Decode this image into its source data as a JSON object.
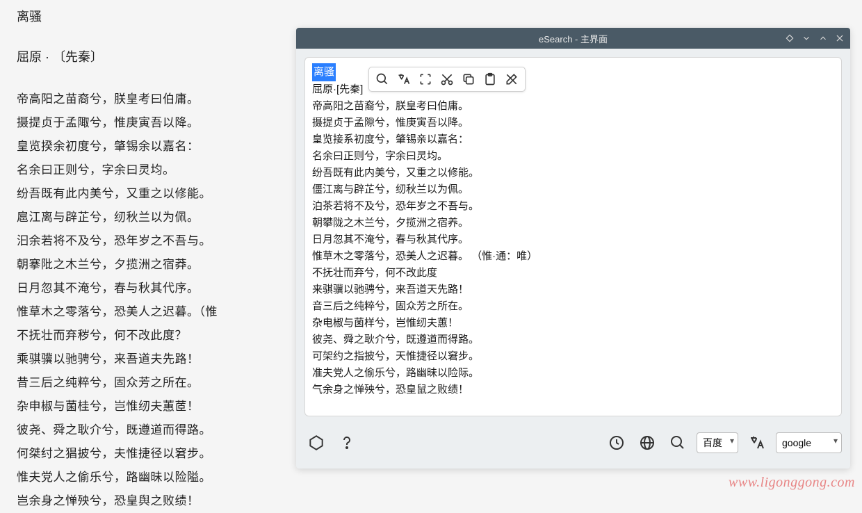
{
  "background": {
    "title": "离骚",
    "author": "屈原 · 〔先秦〕",
    "lines": [
      "帝高阳之苗裔兮，朕皇考曰伯庸。",
      "摄提贞于孟陬兮，惟庚寅吾以降。",
      "皇览揆余初度兮，肇锡余以嘉名：",
      "名余曰正则兮，字余曰灵均。",
      "纷吾既有此内美兮，又重之以修能。",
      "扈江离与辟芷兮，纫秋兰以为佩。",
      "汩余若将不及兮，恐年岁之不吾与。",
      "朝搴阰之木兰兮，夕揽洲之宿莽。",
      "日月忽其不淹兮，春与秋其代序。",
      "惟草木之零落兮，恐美人之迟暮。（惟",
      "不抚壮而弃秽兮，何不改此度？",
      "乘骐骥以驰骋兮，来吾道夫先路！",
      "昔三后之纯粹兮，固众芳之所在。",
      "杂申椒与菌桂兮，岂惟纫夫蕙茝！",
      "彼尧、舜之耿介兮，既遵道而得路。",
      "何桀纣之猖披兮，夫惟捷径以窘步。",
      "惟夫党人之偷乐兮，路幽昧以险隘。",
      "岂余身之惮殃兮，恐皇舆之败绩！"
    ]
  },
  "window": {
    "title": "eSearch - 主界面"
  },
  "editor": {
    "selected_title": "离骚",
    "author_line": "屈原·[先秦]",
    "lines": [
      "帝高阳之苗裔兮，朕皇考曰伯庸。",
      "摄提贞于孟隙兮，惟庚寅吾以降。",
      "皇览接系初度兮，肇锡亲以嘉名：",
      "名余曰正则兮，字余曰灵均。",
      "纷吾既有此内美兮，又重之以修能。",
      "僵江离与辟芷兮，纫秋兰以为佩。",
      "泊茶若将不及兮，恐年岁之不吾与。",
      "朝攀陇之木兰兮，夕揽洲之宿养。",
      "日月忽其不淹兮，春与秋其代序。",
      "惟草木之零落兮，恐美人之迟暮。 （惟·通：唯）",
      "不抚壮而弃兮，何不改此度",
      "来骐骥以驰骋兮，来吾道天先路！",
      "音三后之纯粹兮，固众芳之所在。",
      "杂电椒与菌样兮，岂惟纫夫蕙！",
      "彼尧、舜之耿介兮，既遵道而得路。",
      "可架约之指披兮，天惟捷径以窘步。",
      "准夫党人之偷乐兮，路幽昧以险际。",
      "气余身之惮殃兮，恐皇鼠之败绩！"
    ]
  },
  "footer": {
    "search_engine": "百度",
    "translate_engine": "google"
  },
  "watermark": "www.ligonggong.com"
}
